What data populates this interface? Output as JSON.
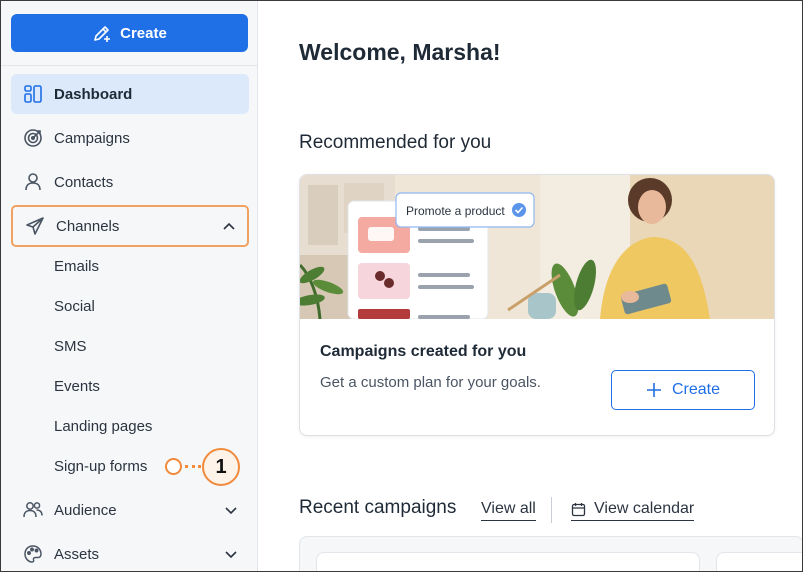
{
  "sidebar": {
    "create_label": "Create",
    "nav": [
      {
        "label": "Dashboard",
        "icon": "dashboard-icon"
      },
      {
        "label": "Campaigns",
        "icon": "target-icon"
      },
      {
        "label": "Contacts",
        "icon": "person-icon"
      },
      {
        "label": "Channels",
        "icon": "send-icon"
      },
      {
        "label": "Audience",
        "icon": "people-icon"
      },
      {
        "label": "Assets",
        "icon": "palette-icon"
      }
    ],
    "channels_sub": [
      "Emails",
      "Social",
      "SMS",
      "Events",
      "Landing pages",
      "Sign-up forms"
    ],
    "callout_number": "1"
  },
  "main": {
    "welcome": "Welcome, Marsha!",
    "recommended_title": "Recommended for you",
    "card": {
      "badge": "Promote a product",
      "title": "Campaigns created for you",
      "subtitle": "Get a custom plan for your goals.",
      "create_label": "Create"
    },
    "recent_title": "Recent campaigns",
    "view_all": "View all",
    "view_calendar": "View calendar"
  },
  "colors": {
    "primary": "#1f6fe6",
    "active_bg": "#dbe9fb",
    "highlight": "#f0a261"
  }
}
